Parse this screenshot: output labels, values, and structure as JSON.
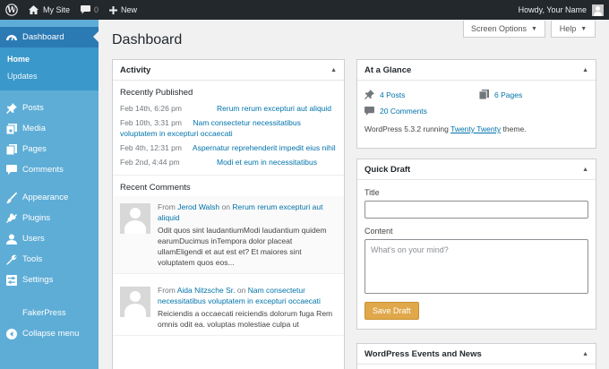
{
  "adminbar": {
    "site_name": "My Site",
    "comments_count": "0",
    "new_label": "New",
    "howdy": "Howdy, Your Name"
  },
  "sidebar": {
    "dashboard": "Dashboard",
    "submenu": [
      "Home",
      "Updates"
    ],
    "items": [
      "Posts",
      "Media",
      "Pages",
      "Comments",
      "Appearance",
      "Plugins",
      "Users",
      "Tools",
      "Settings"
    ],
    "fakerpress": "FakerPress",
    "collapse": "Collapse menu"
  },
  "page": {
    "title": "Dashboard",
    "screen_options": "Screen Options",
    "help": "Help"
  },
  "activity": {
    "title": "Activity",
    "recently_published": "Recently Published",
    "posts": [
      {
        "date": "Feb 14th, 6:26 pm",
        "title": "Rerum rerum excepturi aut aliquid"
      },
      {
        "date": "Feb 10th, 3:31 pm",
        "title": "Nam consectetur necessitatibus voluptatem in excepturi occaecati"
      },
      {
        "date": "Feb 4th, 12:31 pm",
        "title": "Aspernatur reprehenderit impedit eius nihil"
      },
      {
        "date": "Feb 2nd, 4:44 pm",
        "title": "Modi et eum in necessitatibus"
      }
    ],
    "recent_comments": "Recent Comments",
    "comments": [
      {
        "from": "From",
        "author": "Jerod Walsh",
        "on": "on",
        "post": "Rerum rerum excepturi aut aliquid",
        "text": "Odit quos sint laudantiumModi laudantium quidem earumDucimus inTempora dolor placeat ullamEligendi et aut est et? Et maiores sint voluptatem quos eos..."
      },
      {
        "from": "From",
        "author": "Aida Nitzsche Sr.",
        "on": "on",
        "post": "Nam consectetur necessitatibus voluptatem in excepturi occaecati",
        "text": "Reiciendis a occaecati reiciendis dolorum fuga Rem omnis odit ea. voluptas molestiae culpa ut"
      }
    ]
  },
  "glance": {
    "title": "At a Glance",
    "posts": "4 Posts",
    "pages": "6 Pages",
    "comments": "20 Comments",
    "info_prefix": "WordPress 5.3.2 running",
    "theme": "Twenty Twenty",
    "info_suffix": "theme."
  },
  "quick_draft": {
    "title": "Quick Draft",
    "title_label": "Title",
    "content_label": "Content",
    "content_placeholder": "What's on your mind?",
    "save": "Save Draft"
  },
  "events": {
    "title": "WordPress Events and News"
  }
}
